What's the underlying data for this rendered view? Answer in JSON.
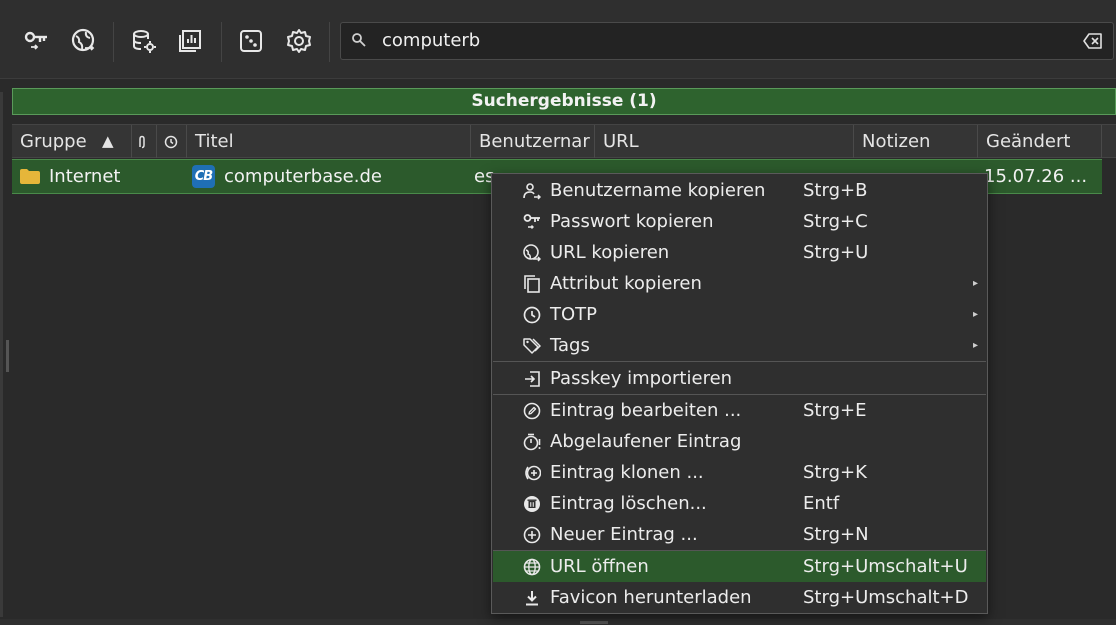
{
  "search": {
    "value": "computerb"
  },
  "results_banner": {
    "label": "Suchergebnisse (1)"
  },
  "table": {
    "headers": {
      "group": "Gruppe",
      "title": "Titel",
      "username": "Benutzernar",
      "url": "URL",
      "notes": "Notizen",
      "modified": "Geändert"
    },
    "sort_indicator": "▲",
    "row": {
      "group": "Internet",
      "favicon_text": "CB",
      "title": "computerbase.de",
      "username": "es",
      "modified": "15.07.26 ..."
    }
  },
  "context_menu": {
    "items": [
      {
        "icon": "user-copy-icon",
        "label": "Benutzername kopieren",
        "shortcut": "Strg+B"
      },
      {
        "icon": "key-copy-icon",
        "label": "Passwort kopieren",
        "shortcut": "Strg+C"
      },
      {
        "icon": "globe-copy-icon",
        "label": "URL kopieren",
        "shortcut": "Strg+U"
      },
      {
        "icon": "copy-icon",
        "label": "Attribut kopieren",
        "submenu": "▸"
      },
      {
        "icon": "clock-icon",
        "label": "TOTP",
        "submenu": "▸"
      },
      {
        "icon": "tags-icon",
        "label": "Tags",
        "submenu": "▸"
      },
      {
        "icon": "import-icon",
        "label": "Passkey importieren"
      },
      {
        "icon": "edit-icon",
        "label": "Eintrag bearbeiten ...",
        "shortcut": "Strg+E"
      },
      {
        "icon": "timer-alert-icon",
        "label": "Abgelaufener Eintrag"
      },
      {
        "icon": "clone-icon",
        "label": "Eintrag klonen ...",
        "shortcut": "Strg+K"
      },
      {
        "icon": "trash-icon",
        "label": "Eintrag löschen...",
        "shortcut": "Entf"
      },
      {
        "icon": "plus-circle-icon",
        "label": "Neuer Eintrag ...",
        "shortcut": "Strg+N"
      },
      {
        "icon": "globe-icon",
        "label": "URL öffnen",
        "shortcut": "Strg+Umschalt+U",
        "active": true
      },
      {
        "icon": "download-icon",
        "label": "Favicon herunterladen",
        "shortcut": "Strg+Umschalt+D"
      }
    ]
  },
  "toolbar_icons": [
    "key-icon",
    "globe-sync-icon",
    "database-settings-icon",
    "report-icon",
    "dice-icon",
    "gear-icon"
  ],
  "colors": {
    "accent_green": "#2c5a2c",
    "banner_border": "#5a9a5a",
    "background": "#2a2a2a"
  }
}
